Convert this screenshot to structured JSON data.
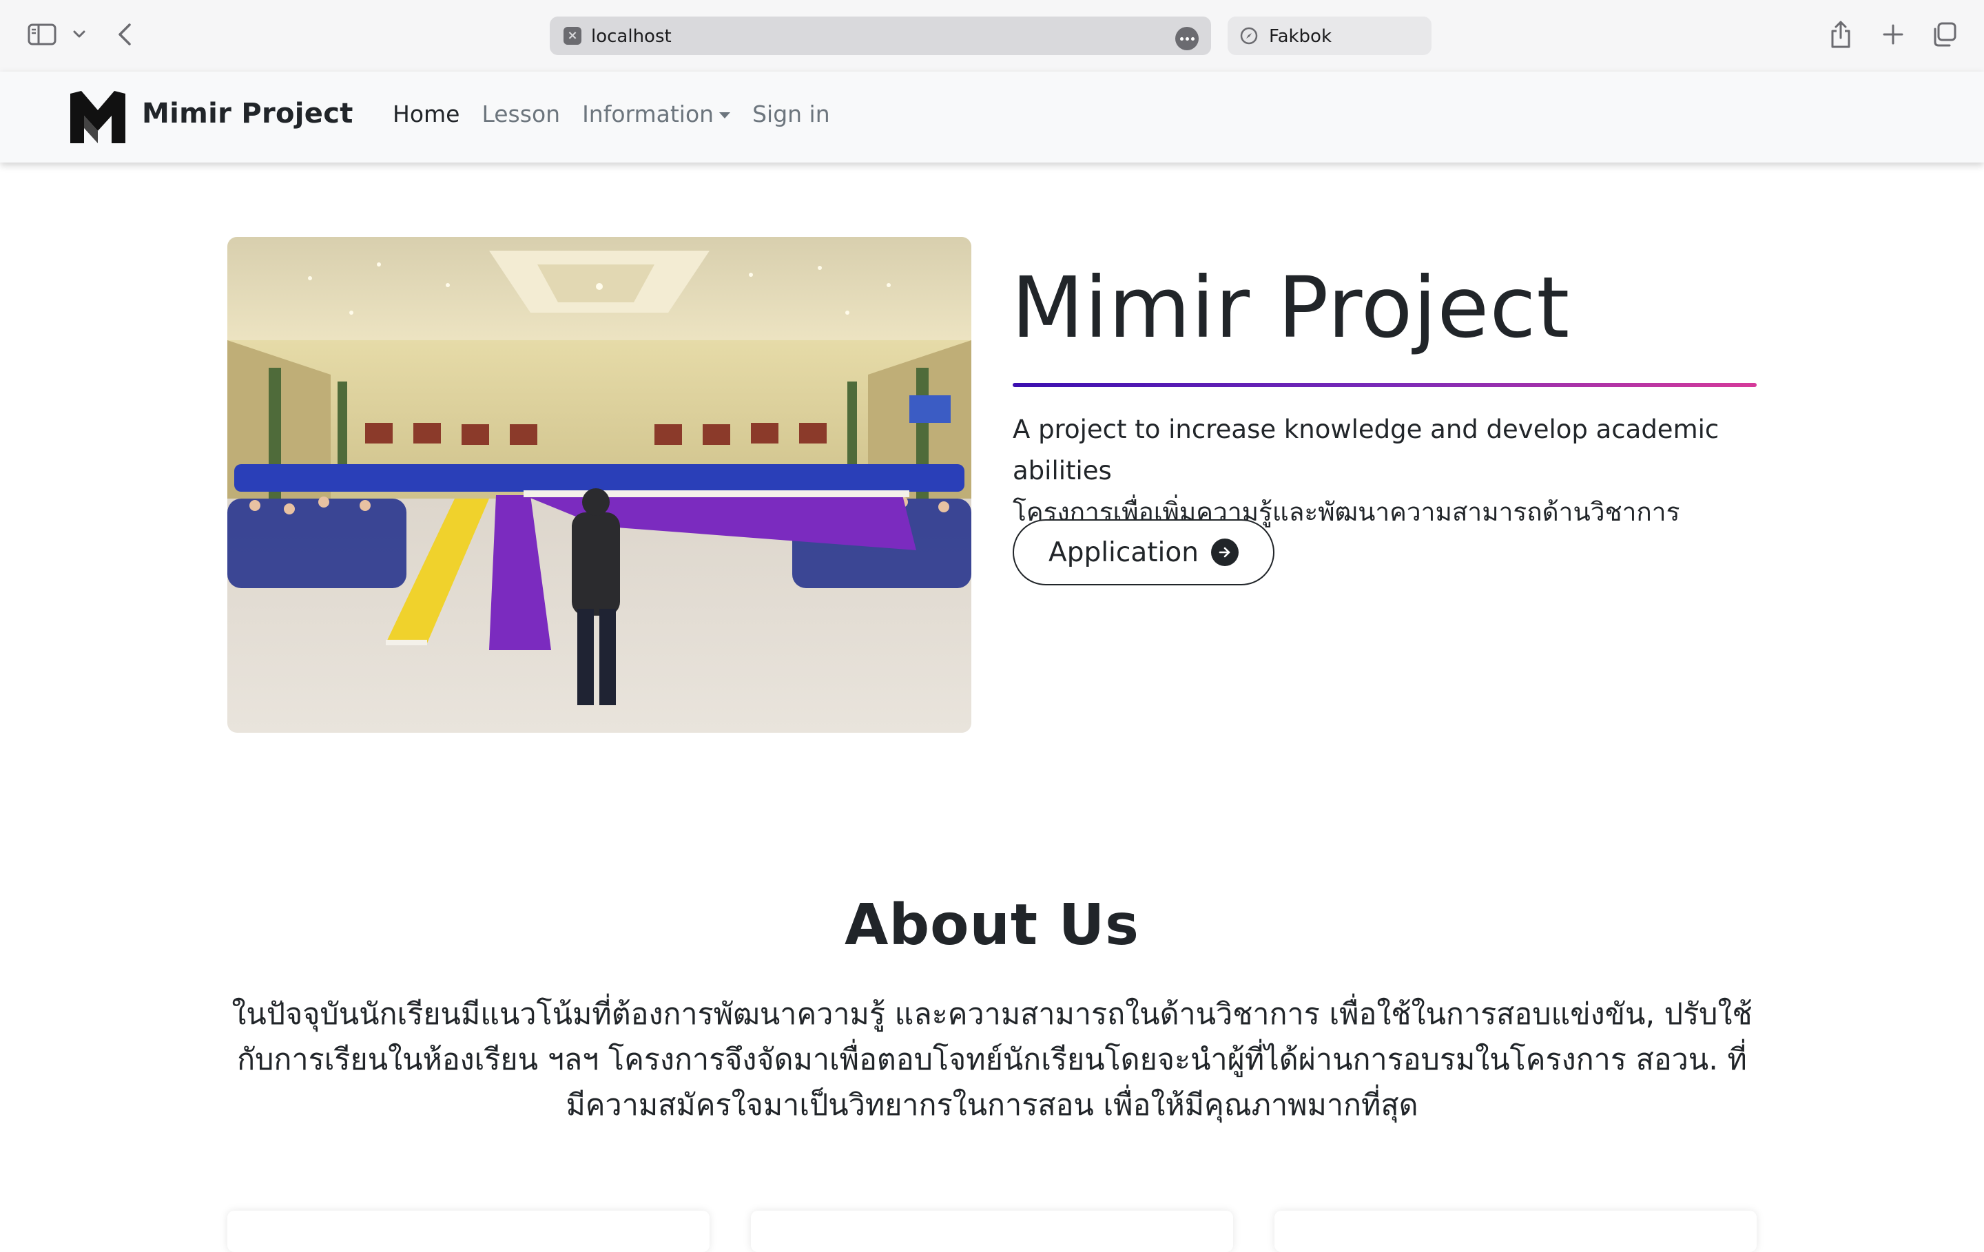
{
  "browser": {
    "url": "localhost",
    "tab_title": "Fakbok"
  },
  "navbar": {
    "brand_name": "Mimir Project",
    "links": [
      {
        "label": "Home",
        "active": true
      },
      {
        "label": "Lesson",
        "active": false
      },
      {
        "label": "Information",
        "active": false,
        "dropdown": true
      },
      {
        "label": "Sign in",
        "active": false
      }
    ]
  },
  "hero": {
    "title": "Mimir Project",
    "subtitle_en": "A project to increase knowledge and develop academic abilities",
    "subtitle_th": "โครงการเพื่อเพิ่มความรู้และพัฒนาความสามารถด้านวิชาการ",
    "button_label": "Application",
    "gradient_colors": [
      "#3b0fb0",
      "#7a2ab8",
      "#d63a9a"
    ]
  },
  "about": {
    "title": "About Us",
    "body": "ในปัจจุบันนักเรียนมีแนวโน้มที่ต้องการพัฒนาความรู้ และความสามารถในด้านวิชาการ เพื่อใช้ในการสอบแข่งขัน, ปรับใช้กับการเรียนในห้องเรียน ฯลฯ โครงการจึงจัดมาเพื่อตอบโจทย์นักเรียนโดยจะนำผู้ที่ได้ผ่านการอบรมในโครงการ สอวน. ที่มีความสมัครใจมาเป็นวิทยากรในการสอน เพื่อให้มีคุณภาพมากที่สุด"
  },
  "icons": {
    "sidebar": "sidebar-icon",
    "back": "chevron-left-icon",
    "share": "share-icon",
    "new_tab": "plus-icon",
    "tabs": "tabs-overview-icon",
    "button_arrow": "arrow-right-circle-icon"
  }
}
